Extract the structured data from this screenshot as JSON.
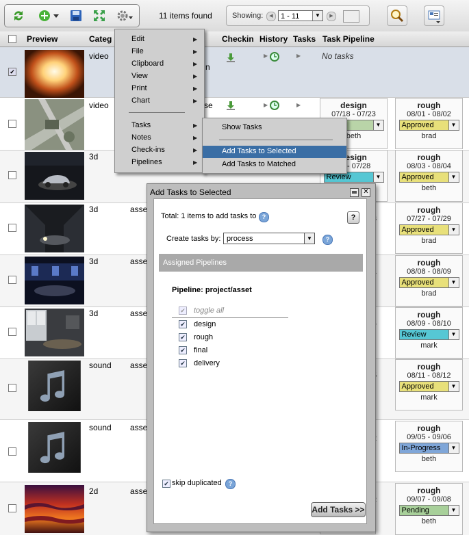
{
  "toolbar": {
    "items_found": "11 items found",
    "showing_label": "Showing:",
    "page_range": "1 - 11",
    "icons": [
      "refresh-icon",
      "add-icon",
      "save-icon",
      "expand-icon",
      "gear-icon",
      "search-icon",
      "view-icon"
    ]
  },
  "table": {
    "columns": [
      "Preview",
      "Categ",
      "Checkin",
      "History",
      "Tasks",
      "Task Pipeline"
    ],
    "no_tasks": "No tasks",
    "peek_col3_row1": "n",
    "peek_col3_row2": "se",
    "rows": [
      {
        "category": "video",
        "asset": "",
        "selected": true
      },
      {
        "category": "video",
        "asset": "",
        "selected": false
      },
      {
        "category": "3d",
        "asset": "",
        "selected": false
      },
      {
        "category": "3d",
        "asset": "asse",
        "selected": false
      },
      {
        "category": "3d",
        "asset": "asse",
        "selected": false
      },
      {
        "category": "3d",
        "asset": "asse",
        "selected": false
      },
      {
        "category": "sound",
        "asset": "asse",
        "selected": false
      },
      {
        "category": "sound",
        "asset": "asse",
        "selected": false
      },
      {
        "category": "2d",
        "asset": "asse",
        "selected": false
      }
    ],
    "pipeline_left": [
      {
        "process": "design",
        "dates": "07/18 - 07/23",
        "status": "g",
        "assignee": "beth",
        "color": "#b9d4a8"
      },
      {
        "process": "design",
        "dates": "28 - 07/28",
        "status": "Review",
        "assignee": "",
        "color": "#56c7d4"
      }
    ],
    "pipeline_peek": [
      "3",
      "1",
      "4",
      "5",
      "2",
      "2"
    ],
    "pipeline_right": [
      {
        "process": "rough",
        "dates": "08/01 - 08/02",
        "status": "Approved",
        "assignee": "brad",
        "color": "#e8e07a"
      },
      {
        "process": "rough",
        "dates": "08/03 - 08/04",
        "status": "Approved",
        "assignee": "beth",
        "color": "#e8e07a"
      },
      {
        "process": "rough",
        "dates": "07/27 - 07/29",
        "status": "Approved",
        "assignee": "brad",
        "color": "#e8e07a"
      },
      {
        "process": "rough",
        "dates": "08/08 - 08/09",
        "status": "Approved",
        "assignee": "brad",
        "color": "#e8e07a"
      },
      {
        "process": "rough",
        "dates": "08/09 - 08/10",
        "status": "Review",
        "assignee": "mark",
        "color": "#56c7d4"
      },
      {
        "process": "rough",
        "dates": "08/11 - 08/12",
        "status": "Approved",
        "assignee": "mark",
        "color": "#e8e07a"
      },
      {
        "process": "rough",
        "dates": "09/05 - 09/06",
        "status": "In-Progress",
        "assignee": "beth",
        "color": "#7fa6d8"
      },
      {
        "process": "rough",
        "dates": "09/07 - 09/08",
        "status": "Pending",
        "assignee": "beth",
        "color": "#a8d09a"
      }
    ]
  },
  "context_menu": {
    "items": [
      "Edit",
      "File",
      "Clipboard",
      "View",
      "Print",
      "Chart",
      "Tasks",
      "Notes",
      "Check-ins",
      "Pipelines"
    ],
    "submenu": [
      "Show Tasks",
      "Add Tasks to Selected",
      "Add Tasks to Matched"
    ]
  },
  "dialog": {
    "title": "Add Tasks to Selected",
    "total": "Total: 1 items to add tasks to",
    "create_by_label": "Create tasks by:",
    "create_by_value": "process",
    "section": "Assigned Pipelines",
    "pipeline": "Pipeline: project/asset",
    "toggle_all": "toggle all",
    "processes": [
      "design",
      "rough",
      "final",
      "delivery"
    ],
    "skip_dup": "skip duplicated",
    "add_btn": "Add Tasks >>",
    "help_q": "?"
  }
}
